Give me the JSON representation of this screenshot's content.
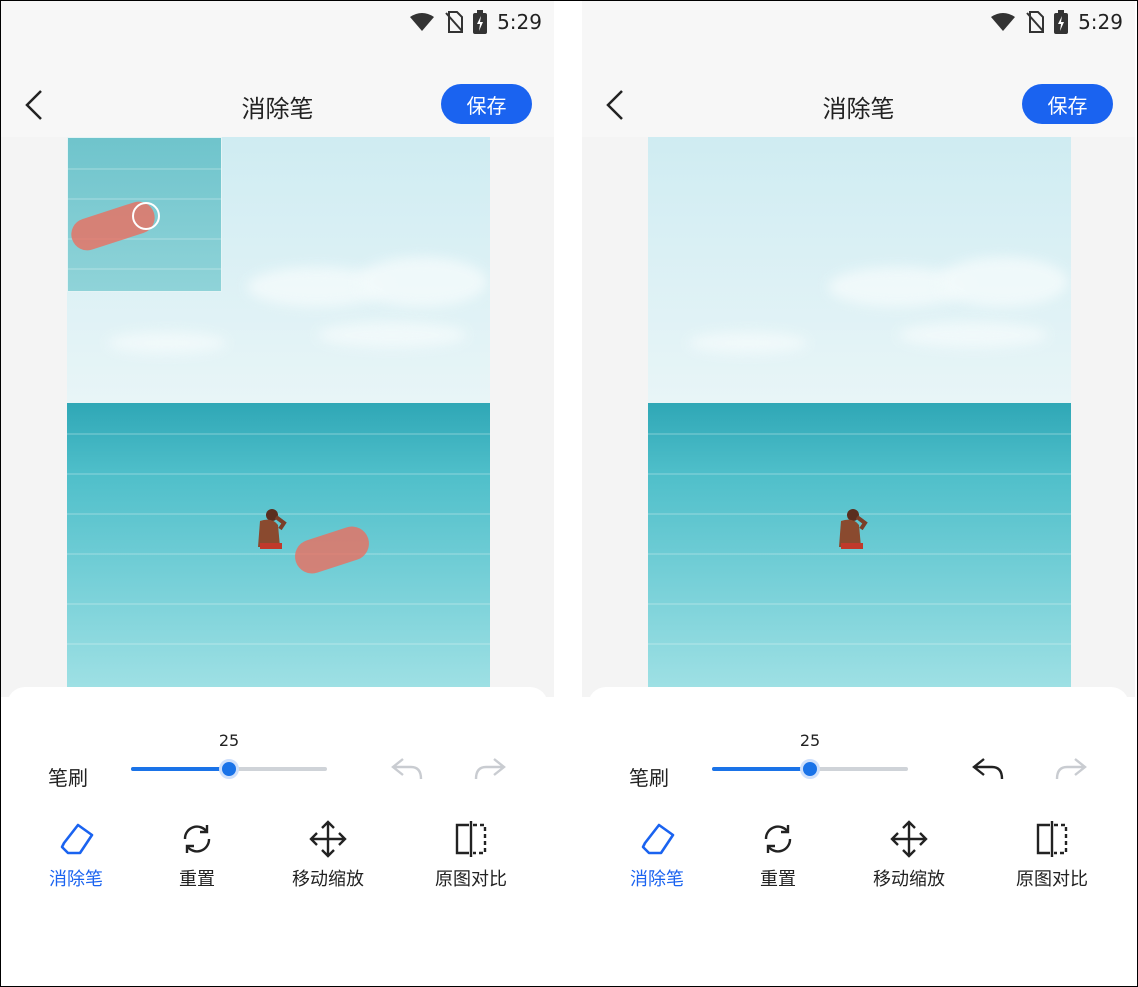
{
  "colors": {
    "accent": "#1a63f0",
    "slider": "#1a73e8",
    "mark": "#eb6e5f"
  },
  "screens": [
    {
      "status": {
        "time": "5:29",
        "icons": [
          "wifi-icon",
          "no-sim-icon",
          "battery-charging-icon"
        ]
      },
      "header": {
        "title": "消除笔",
        "save_label": "保存",
        "back_icon": "back-arrow-icon"
      },
      "brush": {
        "label": "笔刷",
        "value": "25",
        "fraction": 0.5
      },
      "history": {
        "undo_enabled": false,
        "redo_enabled": false
      },
      "tools": [
        {
          "label": "消除笔",
          "icon": "eraser-icon",
          "active": true
        },
        {
          "label": "重置",
          "icon": "reset-icon",
          "active": false
        },
        {
          "label": "移动缩放",
          "icon": "move-icon",
          "active": false
        },
        {
          "label": "原图对比",
          "icon": "compare-icon",
          "active": false
        }
      ]
    },
    {
      "status": {
        "time": "5:29",
        "icons": [
          "wifi-icon",
          "no-sim-icon",
          "battery-charging-icon"
        ]
      },
      "header": {
        "title": "消除笔",
        "save_label": "保存",
        "back_icon": "back-arrow-icon"
      },
      "brush": {
        "label": "笔刷",
        "value": "25",
        "fraction": 0.5
      },
      "history": {
        "undo_enabled": true,
        "redo_enabled": false
      },
      "tools": [
        {
          "label": "消除笔",
          "icon": "eraser-icon",
          "active": true
        },
        {
          "label": "重置",
          "icon": "reset-icon",
          "active": false
        },
        {
          "label": "移动缩放",
          "icon": "move-icon",
          "active": false
        },
        {
          "label": "原图对比",
          "icon": "compare-icon",
          "active": false
        }
      ]
    }
  ]
}
